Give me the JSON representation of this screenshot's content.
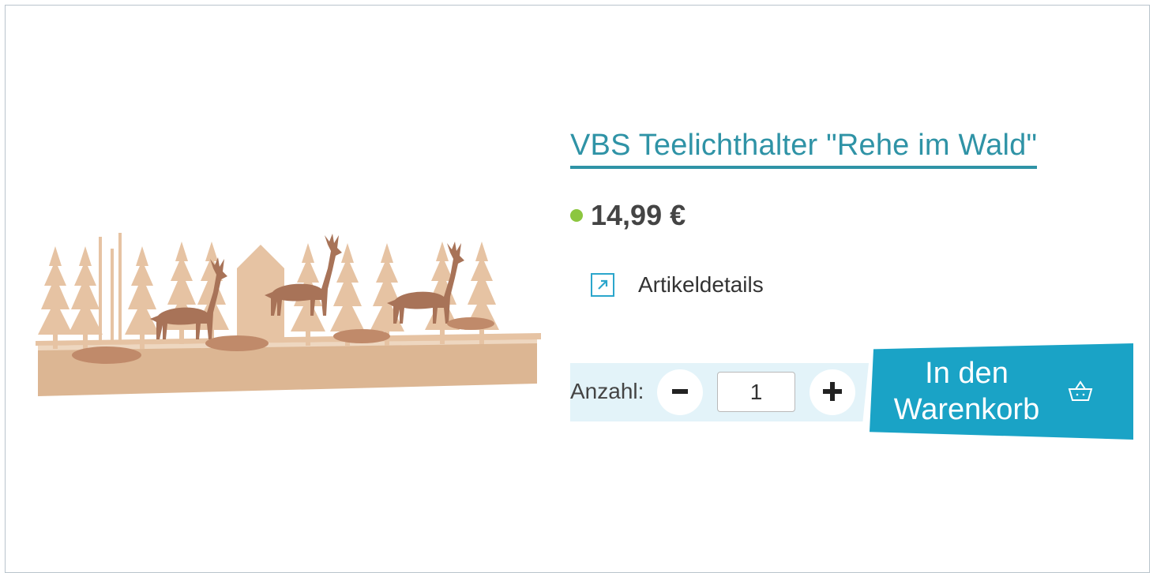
{
  "product": {
    "title": "VBS Teelichthalter \"Rehe im Wald\"",
    "price": "14,99 €",
    "availability_color": "#8cc63f",
    "image_alt": "Teelichthalter mit Rehen und Bäumen aus Holz",
    "details_link_label": "Artikeldetails",
    "details_icon": "external-arrow-icon"
  },
  "quantity": {
    "label": "Anzahl:",
    "value": "1",
    "minus_icon": "minus-icon",
    "plus_icon": "plus-icon"
  },
  "cart": {
    "label_line1": "In den",
    "label_line2": "Warenkorb",
    "icon": "basket-icon",
    "accent_color": "#1aa3c6"
  }
}
